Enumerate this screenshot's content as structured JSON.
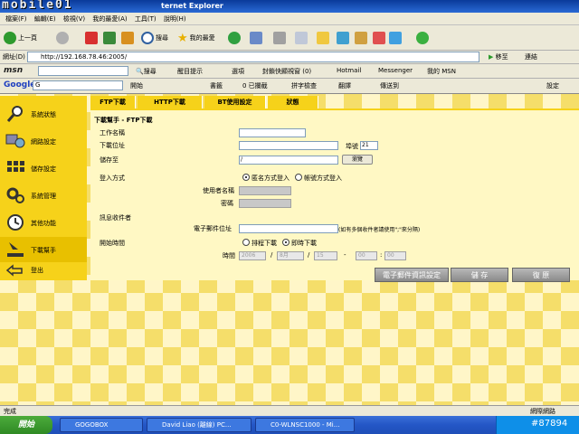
{
  "window": {
    "title": "ternet Explorer",
    "watermark": "mobile01"
  },
  "menu": [
    "檔案(F)",
    "編輯(E)",
    "檢視(V)",
    "我的最愛(A)",
    "工具(T)",
    "說明(H)"
  ],
  "toolbar": {
    "back": "上一頁",
    "search": "搜尋",
    "favorites": "我的最愛"
  },
  "address": {
    "label": "網址(D)",
    "url": "http://192.168.78.46:2005/",
    "go": "移至",
    "links": "連結"
  },
  "msn": {
    "logo": "msn",
    "search": "搜尋",
    "highlight": "醒目提示",
    "options": "選項",
    "popup": "封鎖快顯視窗 (0)",
    "hotmail": "Hotmail",
    "messenger": "Messenger",
    "mymsn": "我的 MSN"
  },
  "google": {
    "logo": "Google",
    "prefix": "G",
    "start": "開始",
    "bookmarks": "書籤",
    "blocked": "0 已攔截",
    "spell": "拼字檢查",
    "translate": "翻譯",
    "sendto": "傳送到",
    "settings": "設定"
  },
  "sidebar": [
    {
      "label": "系統狀態",
      "icon": "magnifier-icon"
    },
    {
      "label": "網路設定",
      "icon": "network-icon"
    },
    {
      "label": "儲存設定",
      "icon": "storage-icon"
    },
    {
      "label": "系統管理",
      "icon": "gears-icon"
    },
    {
      "label": "其他功能",
      "icon": "clock-icon"
    },
    {
      "label": "下載幫手",
      "icon": "download-icon"
    },
    {
      "label": "登出",
      "icon": "logout-arrow-icon"
    }
  ],
  "tabs": [
    "FTP下載",
    "HTTP下載",
    "BT使用設定",
    "狀態"
  ],
  "form": {
    "heading": "下載幫手 - FTP下載",
    "job_name": "工作名稱",
    "download_addr": "下載位址",
    "port_label": "埠號",
    "port_value": "21",
    "save_to": "儲存至",
    "save_value": "/",
    "browse": "瀏覽",
    "login_mode": "登入方式",
    "anonymous": "匿名方式登入",
    "account": "帳號方式登入",
    "username": "使用者名稱",
    "password": "密碼",
    "recipient": "訊息收件者",
    "email": "電子郵件位址",
    "email_note": "(如有多個收件者請使用\";\"來分隔)",
    "start_time": "開始時間",
    "scheduled": "排程下載",
    "immediate": "即時下載",
    "time": "時間",
    "year": "2006",
    "month": "8月",
    "day": "15",
    "hour": "00",
    "minute": "00",
    "sep_slash": "/",
    "sep_dash": "-",
    "sep_colon": ":"
  },
  "buttons": {
    "email_settings": "電子郵件資訊設定",
    "save": "儲 存",
    "restore": "復 原"
  },
  "status": {
    "text": "完成",
    "zone": "網際網路"
  },
  "taskbar": {
    "start": "開始",
    "tasks": [
      "GOGOBOX",
      "David Liao (離線) PC...",
      "C0-WLNSC1000 - Mi..."
    ],
    "tray": "#87894"
  },
  "colors": {
    "accent": "#f6d21a",
    "panel": "#fff8c4",
    "taskbar": "#2456c6"
  }
}
